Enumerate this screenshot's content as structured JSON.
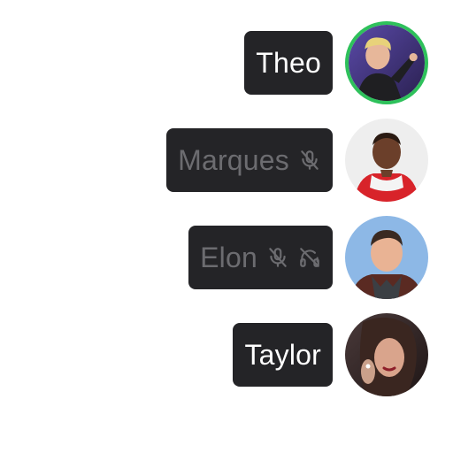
{
  "participants": [
    {
      "name": "Theo",
      "speaking": true,
      "muted": false,
      "deafened": false,
      "avatar": "person-avatar"
    },
    {
      "name": "Marques",
      "speaking": false,
      "muted": true,
      "deafened": false,
      "avatar": "person-avatar"
    },
    {
      "name": "Elon",
      "speaking": false,
      "muted": true,
      "deafened": true,
      "avatar": "person-avatar"
    },
    {
      "name": "Taylor",
      "speaking": false,
      "muted": false,
      "deafened": false,
      "avatar": "person-avatar"
    }
  ],
  "icons": {
    "mute": "mic-off-icon",
    "deafen": "headphones-off-icon"
  },
  "colors": {
    "pill": "#242427",
    "active_text": "#ffffff",
    "muted_text": "#6c6c70",
    "speaking_ring": "#2ec15b"
  }
}
